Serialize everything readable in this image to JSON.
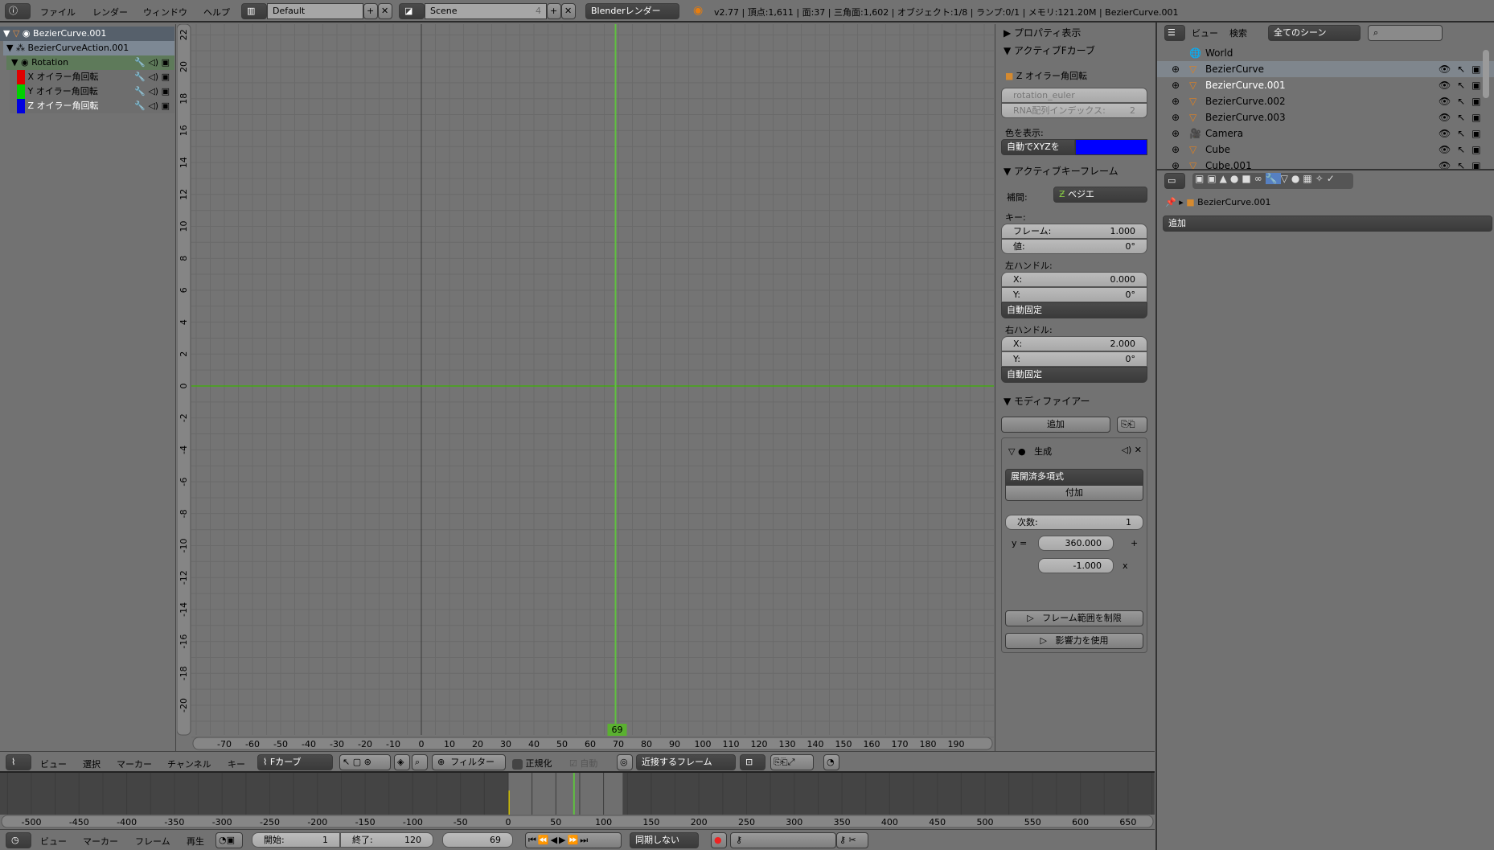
{
  "topbar": {
    "menus": [
      "ファイル",
      "レンダー",
      "ウィンドウ",
      "ヘルプ"
    ],
    "layout": "Default",
    "scene": "Scene",
    "scene_users": "4",
    "engine": "Blenderレンダー",
    "stats": "v2.77 | 頂点:1,611 | 面:37 | 三角面:1,602 | オブジェクト:1/8 | ランプ:0/1 | メモリ:121.20M | BezierCurve.001"
  },
  "channels": [
    {
      "label": "BezierCurve.001",
      "kind": "object"
    },
    {
      "label": "BezierCurveAction.001",
      "kind": "action"
    },
    {
      "label": "Rotation",
      "kind": "group"
    },
    {
      "label": "X オイラー角回転",
      "kind": "curve",
      "color": "#e00000"
    },
    {
      "label": "Y オイラー角回転",
      "kind": "curve",
      "color": "#00d000"
    },
    {
      "label": "Z オイラー角回転",
      "kind": "curve",
      "color": "#0000e0"
    }
  ],
  "graph": {
    "current_frame": "69",
    "x_ticks": [
      -70,
      -60,
      -50,
      -40,
      -30,
      -20,
      -10,
      0,
      10,
      20,
      30,
      40,
      50,
      60,
      70,
      80,
      90,
      100,
      110,
      120,
      130,
      140,
      150,
      160,
      170,
      180,
      190
    ],
    "y_ticks": [
      22,
      20,
      18,
      16,
      14,
      12,
      10,
      8,
      6,
      4,
      2,
      0,
      -2,
      -4,
      -6,
      -8,
      -10,
      -12,
      -14,
      -16,
      -18,
      -20
    ],
    "curve_color": "#3cb400",
    "frame_line_color": "#60c040"
  },
  "props": {
    "view_props": "プロパティ表示",
    "active_fcurve": "アクティブFカーブ",
    "fcurve_name": "Z オイラー角回転",
    "rna_path": "rotation_euler",
    "rna_index_label": "RNA配列インデックス:",
    "rna_index": "2",
    "color_label": "色を表示:",
    "color_mode": "自動でXYZを",
    "color": "#0000ff",
    "active_key": "アクティブキーフレーム",
    "interp_label": "補間:",
    "interp": "ベジエ",
    "key_label": "キー:",
    "frame_label": "フレーム:",
    "frame": "1.000",
    "value_label": "値:",
    "value": "0°",
    "lhandle": "左ハンドル:",
    "lx_label": "X:",
    "lx": "0.000",
    "ly_label": "Y:",
    "ly": "0°",
    "lhandle_type": "自動固定",
    "rhandle": "右ハンドル:",
    "rx_label": "X:",
    "rx": "2.000",
    "ry_label": "Y:",
    "ry": "0°",
    "rhandle_type": "自動固定",
    "modifiers": "モディファイアー",
    "add": "追加",
    "mod_name": "生成",
    "mod_mode": "展開済多項式",
    "additive": "付加",
    "order_label": "次数:",
    "order": "1",
    "y_eq": "y =",
    "coef0": "360.000",
    "plus": "+",
    "coef1": "-1.000",
    "x": "x",
    "restrict": "フレーム範囲を制限",
    "influence": "影響力を使用"
  },
  "outliner": {
    "view": "ビュー",
    "search": "検索",
    "filter": "全てのシーン",
    "items": [
      "World",
      "BezierCurve",
      "BezierCurve.001",
      "BezierCurve.002",
      "BezierCurve.003",
      "Camera",
      "Cube",
      "Cube.001"
    ]
  },
  "properties": {
    "breadcrumb": "BezierCurve.001",
    "add": "追加"
  },
  "graph_header": {
    "menus": [
      "ビュー",
      "選択",
      "マーカー",
      "チャンネル",
      "キー"
    ],
    "mode": "Fカーブ",
    "filter": "フィルター",
    "normalize": "正規化",
    "auto": "自動",
    "pivot": "近接するフレーム"
  },
  "timeline": {
    "ticks": [
      -500,
      -450,
      -400,
      -350,
      -300,
      -250,
      -200,
      -150,
      -100,
      -50,
      0,
      50,
      100,
      150,
      200,
      250,
      300,
      350,
      400,
      450,
      500,
      550,
      600,
      650
    ],
    "menus": [
      "ビュー",
      "マーカー",
      "フレーム",
      "再生"
    ],
    "start_label": "開始:",
    "start": "1",
    "end_label": "終了:",
    "end": "120",
    "current": "69",
    "sync": "同期しない"
  }
}
